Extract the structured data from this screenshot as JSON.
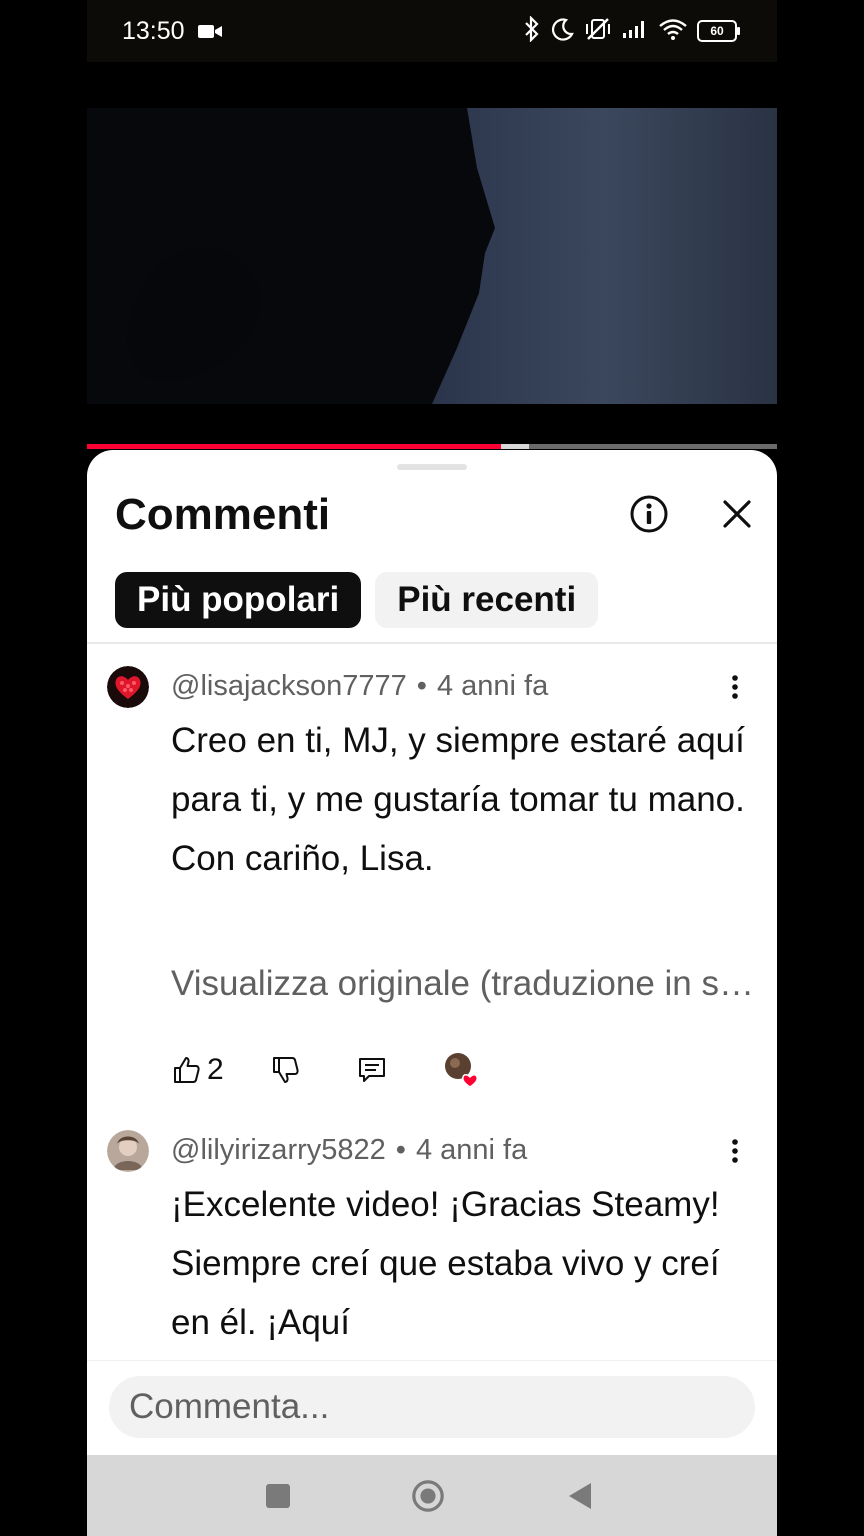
{
  "status_bar": {
    "time": "13:50",
    "battery": "60",
    "icons": [
      "video-camera-icon",
      "bluetooth-icon",
      "moon-icon",
      "vibrate-off-icon",
      "signal-icon",
      "wifi-icon",
      "battery-icon"
    ]
  },
  "video": {
    "progress_fraction": 0.6,
    "buffered_fraction": 0.64
  },
  "comments_panel": {
    "title": "Commenti",
    "tabs": [
      {
        "label": "Più popolari",
        "active": true
      },
      {
        "label": "Più recenti",
        "active": false
      }
    ],
    "comments": [
      {
        "author": "@lisajackson7777",
        "time": "4 anni fa",
        "text": "Creo en ti, MJ, y siempre estaré aquí para ti, y me gustaría tomar tu mano. Con cariño, Lisa.",
        "view_original": "Visualizza originale (traduzione in spagnolo)",
        "likes": "2",
        "creator_heart": true
      },
      {
        "author": "@lilyirizarry5822",
        "time": "4 anni fa",
        "text": "¡Excelente video! ¡Gracias Steamy! Siempre creí que estaba vivo y creí en él. ¡Aquí"
      }
    ],
    "input_placeholder": "Commenta..."
  },
  "colors": {
    "accent": "#ff0033",
    "text": "#0f0f0f",
    "secondary": "#606060",
    "chip_bg": "#f2f2f2"
  }
}
